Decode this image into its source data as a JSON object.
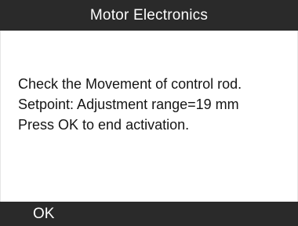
{
  "header": {
    "title": "Motor Electronics"
  },
  "message": {
    "lines": [
      "Check the Movement of control rod.",
      "Setpoint: Adjustment range=19 mm",
      "Press OK to end activation."
    ]
  },
  "footer": {
    "ok_label": "OK"
  },
  "colors": {
    "bar_background": "#2a2a2a",
    "bar_text": "#ffffff",
    "content_background": "#ffffff",
    "content_text": "#151515"
  }
}
